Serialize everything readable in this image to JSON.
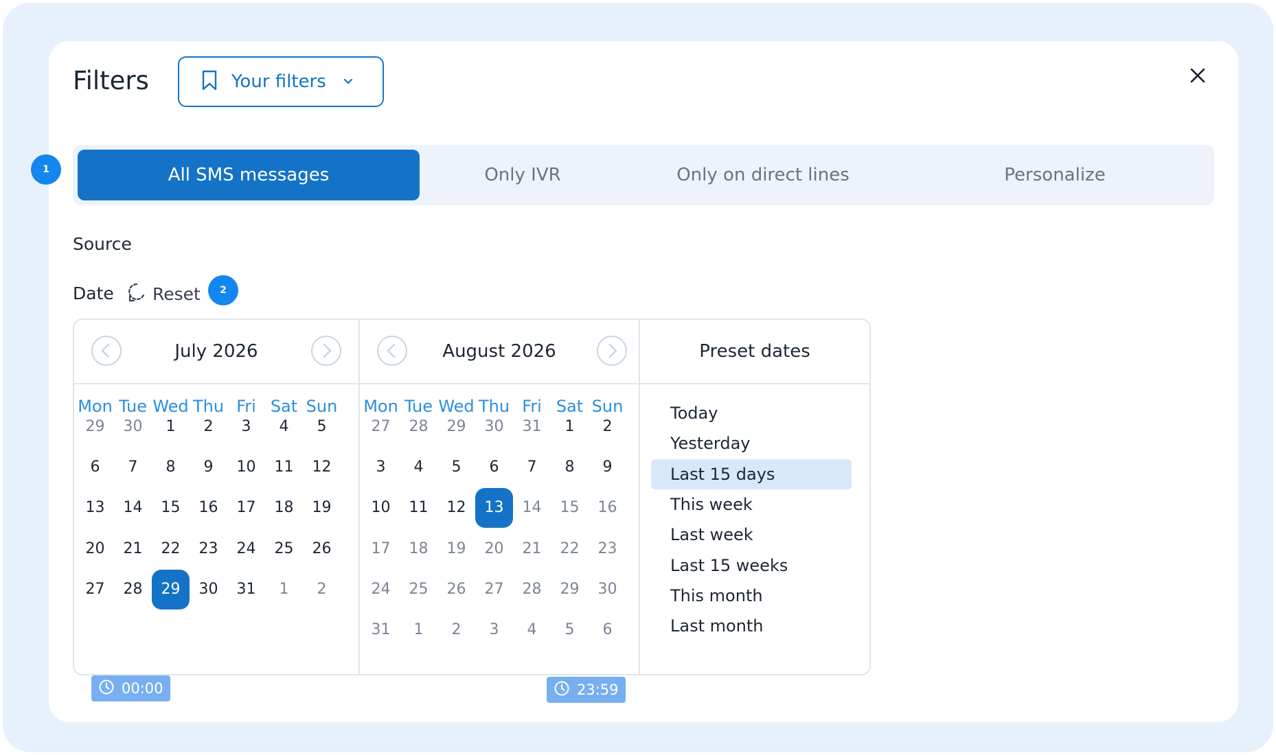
{
  "header": {
    "title": "Filters",
    "filters_button": "Your filters"
  },
  "badges": {
    "tabs": "1",
    "date": "2"
  },
  "tabs": [
    {
      "label": "All SMS messages",
      "active": true
    },
    {
      "label": "Only IVR",
      "active": false
    },
    {
      "label": "Only on direct lines",
      "active": false
    },
    {
      "label": "Personalize",
      "active": false
    }
  ],
  "source_label": "Source",
  "date_label": "Date",
  "reset_label": "Reset",
  "weekdays": [
    "Mon",
    "Tue",
    "Wed",
    "Thu",
    "Fri",
    "Sat",
    "Sun"
  ],
  "calendars": [
    {
      "month": "July 2026",
      "days": [
        [
          "29",
          "30",
          "1",
          "2",
          "3",
          "4",
          "5"
        ],
        [
          "6",
          "7",
          "8",
          "9",
          "10",
          "11",
          "12"
        ],
        [
          "13",
          "14",
          "15",
          "16",
          "17",
          "18",
          "19"
        ],
        [
          "20",
          "21",
          "22",
          "23",
          "24",
          "25",
          "26"
        ],
        [
          "27",
          "28",
          "29",
          "30",
          "31",
          "1",
          "2"
        ]
      ],
      "other_month": [
        [
          0,
          0
        ],
        [
          0,
          1
        ],
        [
          4,
          5
        ],
        [
          4,
          6
        ]
      ],
      "selected": [
        4,
        2
      ]
    },
    {
      "month": "August 2026",
      "days": [
        [
          "27",
          "28",
          "29",
          "30",
          "31",
          "1",
          "2"
        ],
        [
          "3",
          "4",
          "5",
          "6",
          "7",
          "8",
          "9"
        ],
        [
          "10",
          "11",
          "12",
          "13",
          "14",
          "15",
          "16"
        ],
        [
          "17",
          "18",
          "19",
          "20",
          "21",
          "22",
          "23"
        ],
        [
          "24",
          "25",
          "26",
          "27",
          "28",
          "29",
          "30"
        ],
        [
          "31",
          "1",
          "2",
          "3",
          "4",
          "5",
          "6"
        ]
      ],
      "other_month": [
        [
          0,
          0
        ],
        [
          0,
          1
        ],
        [
          0,
          2
        ],
        [
          0,
          3
        ],
        [
          0,
          4
        ],
        [
          2,
          4
        ],
        [
          2,
          5
        ],
        [
          2,
          6
        ],
        [
          3,
          0
        ],
        [
          3,
          1
        ],
        [
          3,
          2
        ],
        [
          3,
          3
        ],
        [
          3,
          4
        ],
        [
          3,
          5
        ],
        [
          3,
          6
        ],
        [
          4,
          0
        ],
        [
          4,
          1
        ],
        [
          4,
          2
        ],
        [
          4,
          3
        ],
        [
          4,
          4
        ],
        [
          4,
          5
        ],
        [
          4,
          6
        ],
        [
          5,
          0
        ],
        [
          5,
          1
        ],
        [
          5,
          2
        ],
        [
          5,
          3
        ],
        [
          5,
          4
        ],
        [
          5,
          5
        ],
        [
          5,
          6
        ]
      ],
      "selected": [
        2,
        3
      ]
    }
  ],
  "presets": {
    "title": "Preset dates",
    "items": [
      "Today",
      "Yesterday",
      "Last 15 days",
      "This week",
      "Last week",
      "Last 15 weeks",
      "This month",
      "Last month"
    ],
    "active_index": 2
  },
  "times": {
    "start": "00:00",
    "end": "23:59"
  },
  "colors": {
    "accent": "#1473c7",
    "weekday": "#2b8ee0",
    "badge": "#1486f0"
  }
}
